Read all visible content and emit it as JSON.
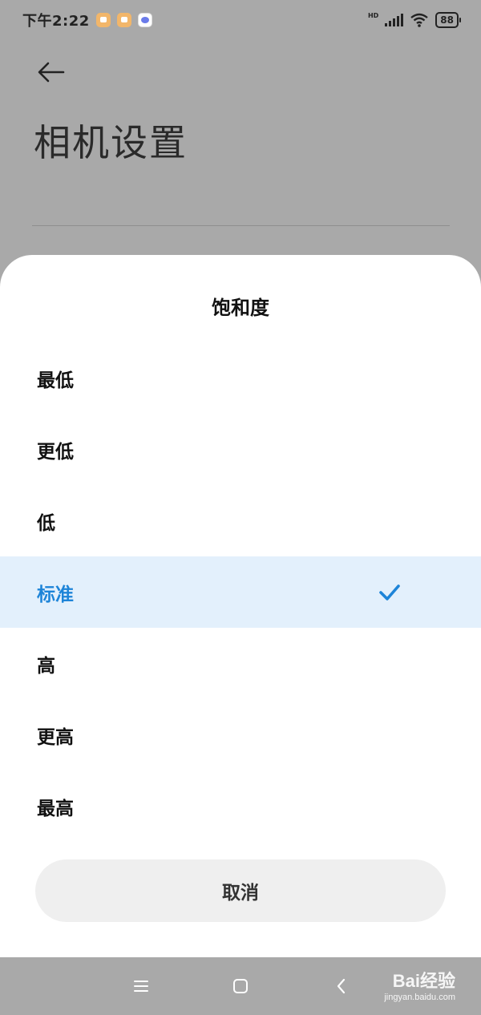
{
  "status_bar": {
    "time": "下午2:22",
    "hd": "HD",
    "battery": "88"
  },
  "page": {
    "title": "相机设置"
  },
  "sheet": {
    "title": "饱和度",
    "options": [
      {
        "label": "最低",
        "selected": false
      },
      {
        "label": "更低",
        "selected": false
      },
      {
        "label": "低",
        "selected": false
      },
      {
        "label": "标准",
        "selected": true
      },
      {
        "label": "高",
        "selected": false
      },
      {
        "label": "更高",
        "selected": false
      },
      {
        "label": "最高",
        "selected": false
      }
    ],
    "cancel_label": "取消"
  },
  "watermark": {
    "logo": "Bai经验",
    "url": "jingyan.baidu.com"
  },
  "colors": {
    "accent": "#1d84d8",
    "selected_bg": "#e3f0fc",
    "dim_overlay": "#a9a9a9"
  }
}
